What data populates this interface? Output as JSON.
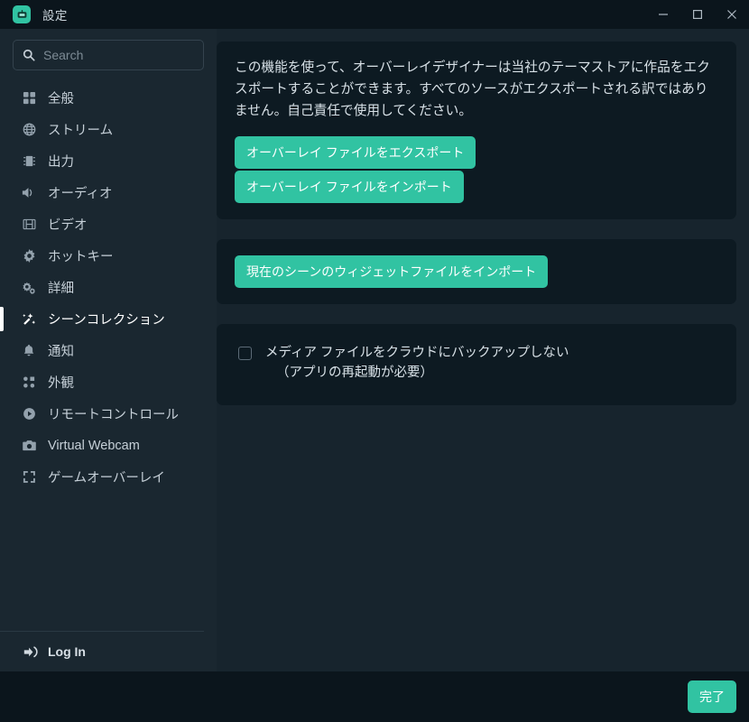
{
  "window": {
    "title": "設定",
    "app_icon": "streamlabs-logo-icon",
    "accent_color": "#31c3a2",
    "controls": {
      "minimize": "minimize-icon",
      "maximize": "maximize-icon",
      "close": "close-icon"
    }
  },
  "search": {
    "placeholder": "Search",
    "value": "",
    "icon": "search-icon"
  },
  "sidebar": {
    "items": [
      {
        "label": "全般",
        "icon": "grid-icon",
        "active": false
      },
      {
        "label": "ストリーム",
        "icon": "globe-icon",
        "active": false
      },
      {
        "label": "出力",
        "icon": "chip-icon",
        "active": false
      },
      {
        "label": "オーディオ",
        "icon": "speaker-icon",
        "active": false
      },
      {
        "label": "ビデオ",
        "icon": "film-icon",
        "active": false
      },
      {
        "label": "ホットキー",
        "icon": "gear-icon",
        "active": false
      },
      {
        "label": "詳細",
        "icon": "gears-icon",
        "active": false
      },
      {
        "label": "シーンコレクション",
        "icon": "magic-wand-icon",
        "active": true
      },
      {
        "label": "通知",
        "icon": "bell-icon",
        "active": false
      },
      {
        "label": "外観",
        "icon": "dots-grid-icon",
        "active": false
      },
      {
        "label": "リモートコントロール",
        "icon": "play-circle-icon",
        "active": false
      },
      {
        "label": "Virtual Webcam",
        "icon": "camera-icon",
        "active": false
      },
      {
        "label": "ゲームオーバーレイ",
        "icon": "expand-icon",
        "active": false
      }
    ],
    "login": {
      "label": "Log In",
      "icon": "login-arrow-icon"
    }
  },
  "main": {
    "overlay_card": {
      "description": "この機能を使って、オーバーレイデザイナーは当社のテーマストアに作品をエクスポートすることができます。すべてのソースがエクスポートされる訳ではありません。自己責任で使用してください。",
      "export_button": "オーバーレイ ファイルをエクスポート",
      "import_button": "オーバーレイ ファイルをインポート"
    },
    "widget_card": {
      "import_widget_button": "現在のシーンのウィジェットファイルをインポート"
    },
    "backup_card": {
      "checkbox_checked": false,
      "checkbox_label_line1": "メディア ファイルをクラウドにバックアップしない",
      "checkbox_label_line2": "（アプリの再起動が必要）"
    }
  },
  "footer": {
    "done_button": "完了"
  }
}
